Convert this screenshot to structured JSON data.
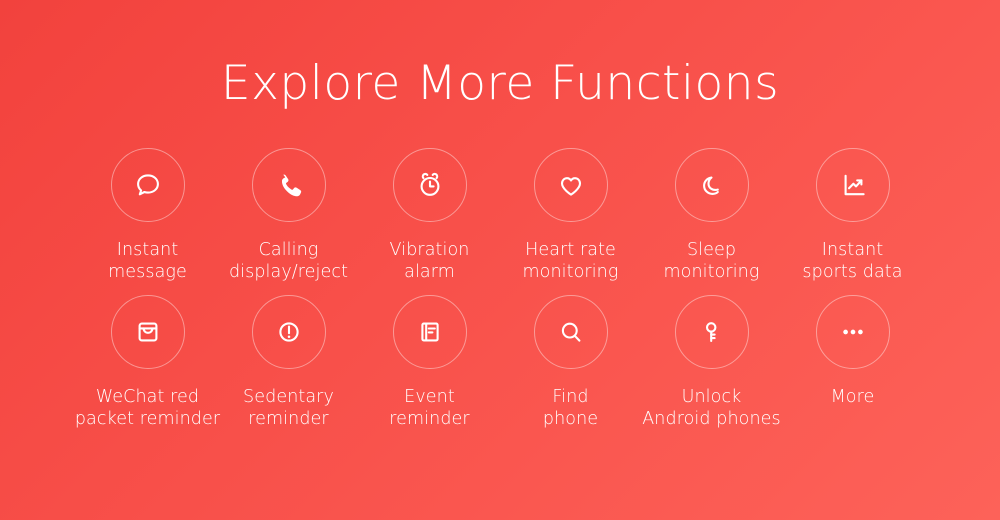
{
  "page": {
    "title": "Explore More Functions",
    "background_color_start": "#f2423d",
    "background_color_mid": "#f8504a",
    "background_color_end": "#fd6259",
    "text_color": "#ffffff",
    "circle_border_color": "rgba(255,255,255,0.42)"
  },
  "features": {
    "row1": [
      {
        "icon": "speech-bubble-icon",
        "line1": "Instant",
        "line2": "message"
      },
      {
        "icon": "phone-handset-icon",
        "line1": "Calling",
        "line2": "display/reject"
      },
      {
        "icon": "alarm-clock-icon",
        "line1": "Vibration",
        "line2": "alarm"
      },
      {
        "icon": "heart-icon",
        "line1": "Heart rate",
        "line2": "monitoring"
      },
      {
        "icon": "crescent-moon-icon",
        "line1": "Sleep",
        "line2": "monitoring"
      },
      {
        "icon": "line-chart-icon",
        "line1": "Instant",
        "line2": "sports data"
      }
    ],
    "row2": [
      {
        "icon": "inbox-envelope-icon",
        "line1": "WeChat red",
        "line2": "packet reminder"
      },
      {
        "icon": "exclamation-circle-icon",
        "line1": "Sedentary",
        "line2": "reminder"
      },
      {
        "icon": "document-note-icon",
        "line1": "Event",
        "line2": "reminder"
      },
      {
        "icon": "magnifier-search-icon",
        "line1": "Find",
        "line2": "phone"
      },
      {
        "icon": "key-icon",
        "line1": "Unlock",
        "line2": "Android phones"
      },
      {
        "icon": "ellipsis-icon",
        "line1": "More",
        "line2": ""
      }
    ]
  }
}
